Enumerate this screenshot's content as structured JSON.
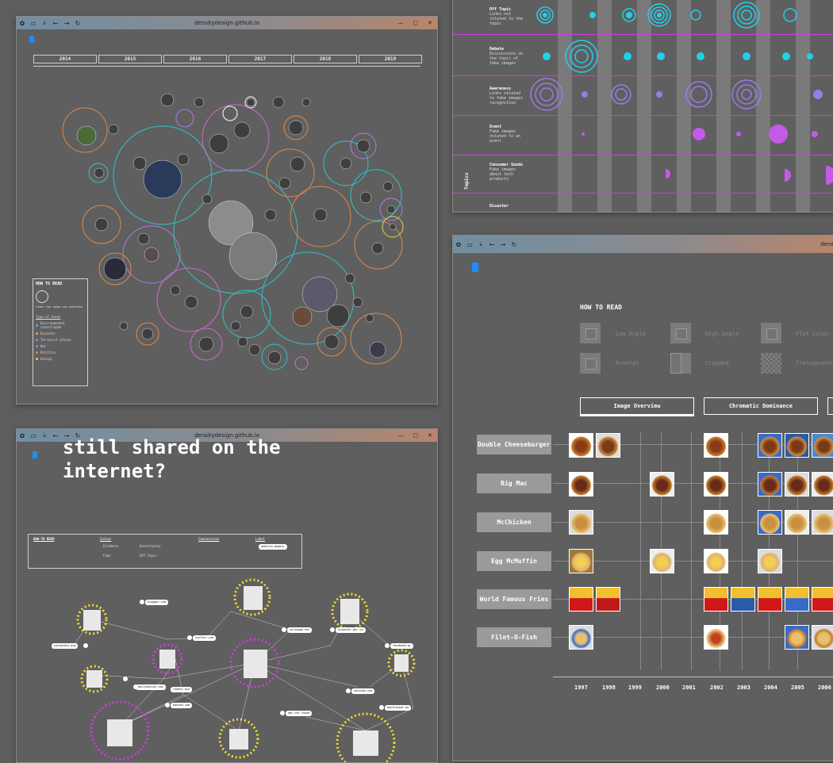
{
  "windows": {
    "timeline": {
      "url": "densitydesign.github.io",
      "years": [
        "2014",
        "2015",
        "2016",
        "2017",
        "2018",
        "2019"
      ],
      "how_to_read": {
        "title": "HOW TO READ",
        "size_caption": "Times the image was debunked",
        "type_title": "Type of event",
        "types": [
          {
            "label": "Environmental catastrophe",
            "color": "#2ec4c9"
          },
          {
            "label": "Disaster",
            "color": "#e0b040"
          },
          {
            "label": "Terrorist attack",
            "color": "#b07be0"
          },
          {
            "label": "War",
            "color": "#d06ad0"
          },
          {
            "label": "Politics",
            "color": "#e08a4a"
          },
          {
            "label": "Gossip",
            "color": "#e8d44a"
          }
        ]
      }
    },
    "network": {
      "url": "densitydesign.github.io",
      "title_line1": "still shared on the",
      "title_line2": "internet?",
      "legend": {
        "how_to_read": "HOW TO READ",
        "colour": "Colour",
        "connections": "Connections",
        "label": "Label",
        "evidence": "Evidence",
        "fake": "Fake",
        "uncertainty": "Uncertainty",
        "off_topic": "OFF Topic",
        "website_label": "website.domain"
      },
      "sites": [
        "blogger.com",
        "twitter.com",
        "verimage.net",
        "bleather.mar.co",
        "wikipedia.org",
        "facebook.gr",
        "dailymotion.com",
        "reddit.hio",
        "youtube.com",
        "banned.com",
        "abc not found",
        "mentormeat.be"
      ]
    },
    "topics": {
      "axis_label": "Topics",
      "rows": [
        {
          "title": "Off Topic",
          "desc": "Links not related to the topic"
        },
        {
          "title": "Debate",
          "desc": "Discussions on the topic of fake images"
        },
        {
          "title": "Awareness",
          "desc": "Links related to fake images recognition"
        },
        {
          "title": "Event",
          "desc": "Fake images related to an event"
        },
        {
          "title": "Consumer Goods",
          "desc": "Fake images about tech products"
        },
        {
          "title": "Disaster",
          "desc": ""
        }
      ]
    },
    "mcdonalds": {
      "url": "densitydesign",
      "how_to_read": "HOW TO READ",
      "swatches": [
        "Low Angle",
        "High Angle",
        "Flat Color",
        "Frontal",
        "Cropped",
        "Transparent"
      ],
      "tabs": [
        "Image Overview",
        "Chromatic Dominance"
      ],
      "rows": [
        "Double Cheeseburger",
        "Big Mac",
        "McChicken",
        "Egg McMuffin",
        "World Famous Fries",
        "Filet-O-Fish"
      ],
      "years": [
        "1997",
        "1998",
        "1999",
        "2000",
        "2001",
        "2002",
        "2003",
        "2004",
        "2005",
        "2006"
      ]
    }
  }
}
